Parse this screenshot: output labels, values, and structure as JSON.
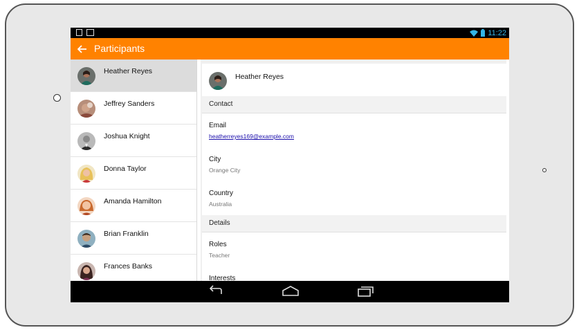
{
  "status": {
    "time": "11:22"
  },
  "actionbar": {
    "title": "Participants"
  },
  "participants": [
    {
      "name": "Heather Reyes",
      "selected": true
    },
    {
      "name": "Jeffrey Sanders"
    },
    {
      "name": "Joshua Knight"
    },
    {
      "name": "Donna Taylor"
    },
    {
      "name": "Amanda Hamilton"
    },
    {
      "name": "Brian Franklin"
    },
    {
      "name": "Frances Banks"
    }
  ],
  "detail": {
    "name": "Heather Reyes",
    "contact_section": "Contact",
    "email_label": "Email",
    "email_value": "heatherreyes169@example.com",
    "city_label": "City",
    "city_value": "Orange City",
    "country_label": "Country",
    "country_value": "Australia",
    "details_section": "Details",
    "roles_label": "Roles",
    "roles_value": "Teacher",
    "interests_label": "Interests"
  },
  "colors": {
    "accent": "#ff8200",
    "status_time": "#33b5e5",
    "link": "#1a0dab"
  }
}
